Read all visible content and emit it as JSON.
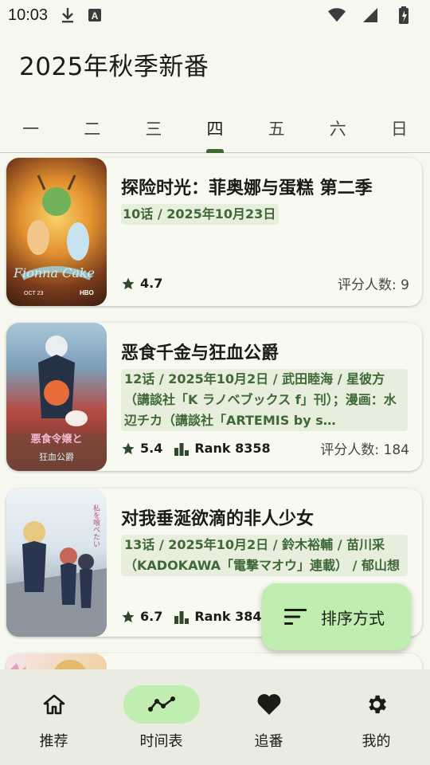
{
  "status_bar": {
    "time": "10:03",
    "icons": [
      "download-icon",
      "keyboard-a-icon",
      "wifi-icon",
      "signal-icon",
      "battery-icon"
    ]
  },
  "title": "2025年秋季新番",
  "tabs": [
    "一",
    "二",
    "三",
    "四",
    "五",
    "六",
    "日"
  ],
  "active_tab": "四",
  "cards": [
    {
      "title": "探险时光：菲奥娜与蛋糕 第二季",
      "subtitle": "10话 / 2025年10月23日",
      "rating": "4.7",
      "rank": "",
      "count": "评分人数: 9"
    },
    {
      "title": "恶食千金与狂血公爵",
      "subtitle": "12话 / 2025年10月2日 / 武田睦海 / 星彼方（講談社「K ラノベブックス f」刊）；漫画：水辺チカ（講談社「ARTEMIS by s…",
      "rating": "5.4",
      "rank": "Rank 8358",
      "count": "评分人数: 184"
    },
    {
      "title": "对我垂涎欲滴的非人少女",
      "subtitle": "13话 / 2025年10月2日 / 鈴木裕輔 / 苗川采（KADOKAWA「電撃マオウ」連載） / 郁山想",
      "rating": "6.7",
      "rank": "Rank 3849",
      "count": ""
    }
  ],
  "fab": {
    "label": "排序方式"
  },
  "bottom_nav": [
    {
      "label": "推荐",
      "icon": "home-icon"
    },
    {
      "label": "时间表",
      "icon": "timeline-icon"
    },
    {
      "label": "追番",
      "icon": "heart-icon"
    },
    {
      "label": "我的",
      "icon": "gear-icon"
    }
  ],
  "active_nav": "时间表",
  "colors": {
    "background": "#f6f8ef",
    "accent": "#3f6837",
    "fab": "#c0eeb0",
    "nav_bg": "#eaece2"
  }
}
